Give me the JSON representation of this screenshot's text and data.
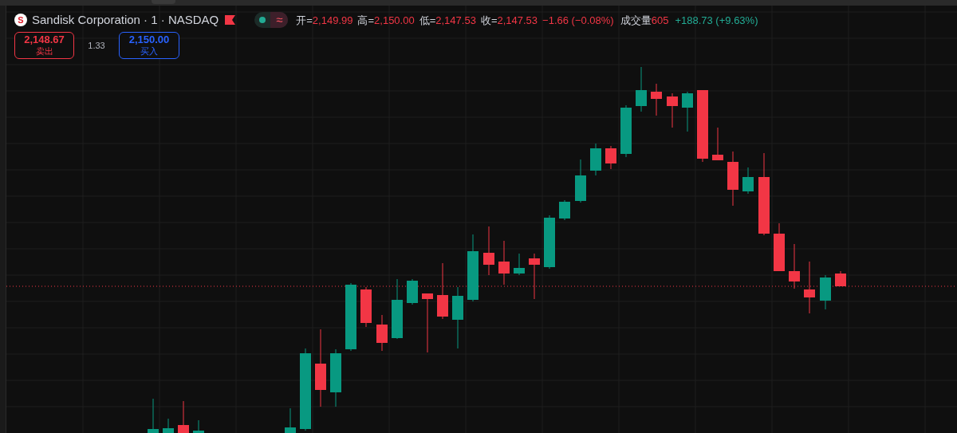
{
  "legend": {
    "logo": "S",
    "title": "Sandisk Corporation · 1 · NASDAQ",
    "indicator_symbol": "≈",
    "ohlc": [
      {
        "label": "开=",
        "value": "2,149.99"
      },
      {
        "label": "高=",
        "value": "2,150.00"
      },
      {
        "label": "低=",
        "value": "2,147.53"
      },
      {
        "label": "收=",
        "value": "2,147.53"
      }
    ],
    "change": "−1.66 (−0.08%)",
    "volume": {
      "label": "成交量",
      "value": "605"
    },
    "indicator_value": "+188.73 (+9.63%)"
  },
  "trade": {
    "sell": {
      "price": "2,148.67",
      "label": "卖出"
    },
    "spread": "1.33",
    "buy": {
      "price": "2,150.00",
      "label": "买入"
    }
  }
}
